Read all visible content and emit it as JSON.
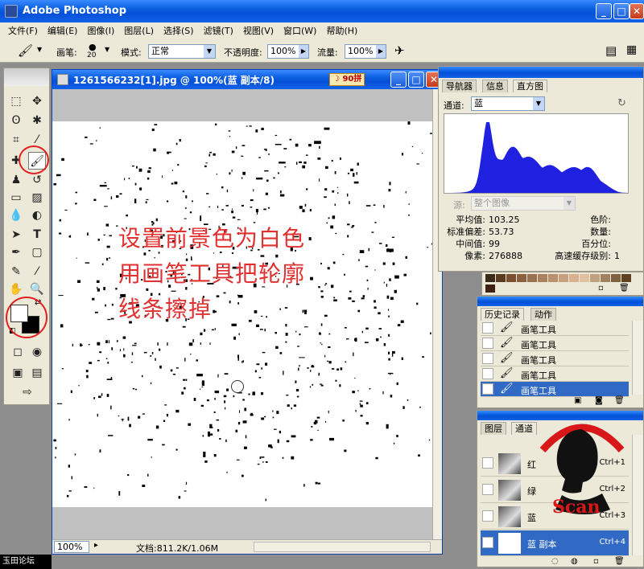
{
  "app": {
    "title": "Adobe Photoshop"
  },
  "menu": [
    "文件(F)",
    "编辑(E)",
    "图像(I)",
    "图层(L)",
    "选择(S)",
    "滤镜(T)",
    "视图(V)",
    "窗口(W)",
    "帮助(H)"
  ],
  "options": {
    "brush_label": "画笔:",
    "brush_size": "20",
    "mode_label": "模式:",
    "mode_value": "正常",
    "opacity_label": "不透明度:",
    "opacity_value": "100%",
    "flow_label": "流量:",
    "flow_value": "100%"
  },
  "document": {
    "title": "1261566232[1].jpg @ 100%(蓝 副本/8)",
    "ime": "90拼",
    "annotation": [
      "设置前景色为白色",
      "用画笔工具把轮廓",
      "线条擦掉"
    ],
    "zoom": "100%",
    "doc_info": "文档:811.2K/1.06M"
  },
  "histogram": {
    "tabs": [
      "导航器",
      "信息",
      "直方图"
    ],
    "channel_label": "通道:",
    "channel_value": "蓝",
    "source_label": "源:",
    "source_value": "整个图像",
    "stats": [
      {
        "label": "平均值:",
        "value": "103.25"
      },
      {
        "label": "标准偏差:",
        "value": "53.73"
      },
      {
        "label": "中间值:",
        "value": "99"
      },
      {
        "label": "像素:",
        "value": "276888"
      }
    ],
    "stats_right": [
      {
        "label": "色阶:",
        "value": ""
      },
      {
        "label": "数量:",
        "value": ""
      },
      {
        "label": "百分位:",
        "value": ""
      },
      {
        "label": "高速缓存级别:",
        "value": "1"
      }
    ],
    "color": "#2020e0"
  },
  "history": {
    "tabs": [
      "历史记录",
      "动作"
    ],
    "items": [
      "画笔工具",
      "画笔工具",
      "画笔工具",
      "画笔工具",
      "画笔工具"
    ],
    "selected_index": 4
  },
  "channels": {
    "tabs": [
      "图层",
      "通道"
    ],
    "rows": [
      {
        "name": "红",
        "key": "Ctrl+1"
      },
      {
        "name": "绿",
        "key": "Ctrl+2"
      },
      {
        "name": "蓝",
        "key": "Ctrl+3"
      },
      {
        "name": "蓝 副本",
        "key": "Ctrl+4"
      }
    ]
  },
  "logo": {
    "text": "Scan"
  },
  "watermark": "玉田论坛"
}
